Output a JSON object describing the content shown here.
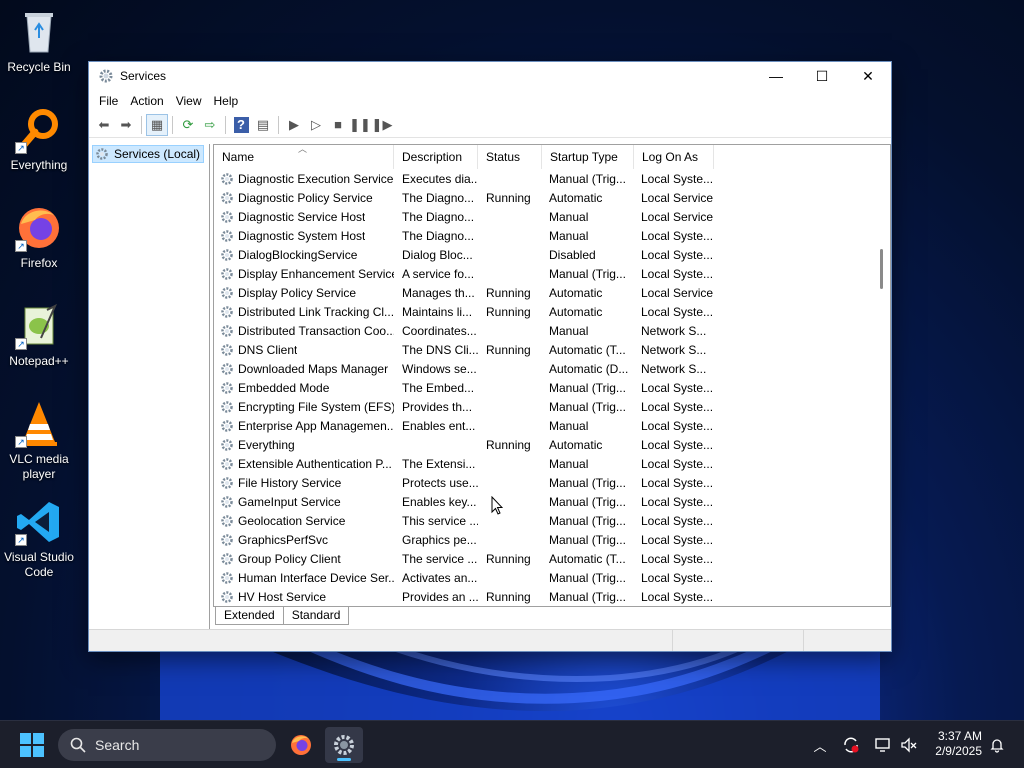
{
  "desktop": {
    "icons": [
      {
        "label": "Recycle Bin"
      },
      {
        "label": "Everything"
      },
      {
        "label": "Firefox"
      },
      {
        "label": "Notepad++"
      },
      {
        "label": "VLC media player"
      },
      {
        "label": "Visual Studio Code"
      }
    ]
  },
  "window": {
    "title": "Services",
    "menu": [
      "File",
      "Action",
      "View",
      "Help"
    ],
    "tree_item": "Services (Local)",
    "columns": [
      "Name",
      "Description",
      "Status",
      "Startup Type",
      "Log On As"
    ],
    "rows": [
      [
        "Diagnostic Execution Service",
        "Executes dia...",
        "",
        "Manual (Trig...",
        "Local Syste..."
      ],
      [
        "Diagnostic Policy Service",
        "The Diagno...",
        "Running",
        "Automatic",
        "Local Service"
      ],
      [
        "Diagnostic Service Host",
        "The Diagno...",
        "",
        "Manual",
        "Local Service"
      ],
      [
        "Diagnostic System Host",
        "The Diagno...",
        "",
        "Manual",
        "Local Syste..."
      ],
      [
        "DialogBlockingService",
        "Dialog Bloc...",
        "",
        "Disabled",
        "Local Syste..."
      ],
      [
        "Display Enhancement Service",
        "A service fo...",
        "",
        "Manual (Trig...",
        "Local Syste..."
      ],
      [
        "Display Policy Service",
        "Manages th...",
        "Running",
        "Automatic",
        "Local Service"
      ],
      [
        "Distributed Link Tracking Cl...",
        "Maintains li...",
        "Running",
        "Automatic",
        "Local Syste..."
      ],
      [
        "Distributed Transaction Coo...",
        "Coordinates...",
        "",
        "Manual",
        "Network S..."
      ],
      [
        "DNS Client",
        "The DNS Cli...",
        "Running",
        "Automatic (T...",
        "Network S..."
      ],
      [
        "Downloaded Maps Manager",
        "Windows se...",
        "",
        "Automatic (D...",
        "Network S..."
      ],
      [
        "Embedded Mode",
        "The Embed...",
        "",
        "Manual (Trig...",
        "Local Syste..."
      ],
      [
        "Encrypting File System (EFS)",
        "Provides th...",
        "",
        "Manual (Trig...",
        "Local Syste..."
      ],
      [
        "Enterprise App Managemen...",
        "Enables ent...",
        "",
        "Manual",
        "Local Syste..."
      ],
      [
        "Everything",
        "",
        "Running",
        "Automatic",
        "Local Syste..."
      ],
      [
        "Extensible Authentication P...",
        "The Extensi...",
        "",
        "Manual",
        "Local Syste..."
      ],
      [
        "File History Service",
        "Protects use...",
        "",
        "Manual (Trig...",
        "Local Syste..."
      ],
      [
        "GameInput Service",
        "Enables key...",
        "",
        "Manual (Trig...",
        "Local Syste..."
      ],
      [
        "Geolocation Service",
        "This service ...",
        "",
        "Manual (Trig...",
        "Local Syste..."
      ],
      [
        "GraphicsPerfSvc",
        "Graphics pe...",
        "",
        "Manual (Trig...",
        "Local Syste..."
      ],
      [
        "Group Policy Client",
        "The service ...",
        "Running",
        "Automatic (T...",
        "Local Syste..."
      ],
      [
        "Human Interface Device Ser...",
        "Activates an...",
        "",
        "Manual (Trig...",
        "Local Syste..."
      ],
      [
        "HV Host Service",
        "Provides an ...",
        "Running",
        "Manual (Trig...",
        "Local Syste..."
      ]
    ],
    "tabs": [
      "Extended",
      "Standard"
    ]
  },
  "taskbar": {
    "search_placeholder": "Search",
    "time": "3:37 AM",
    "date": "2/9/2025"
  }
}
